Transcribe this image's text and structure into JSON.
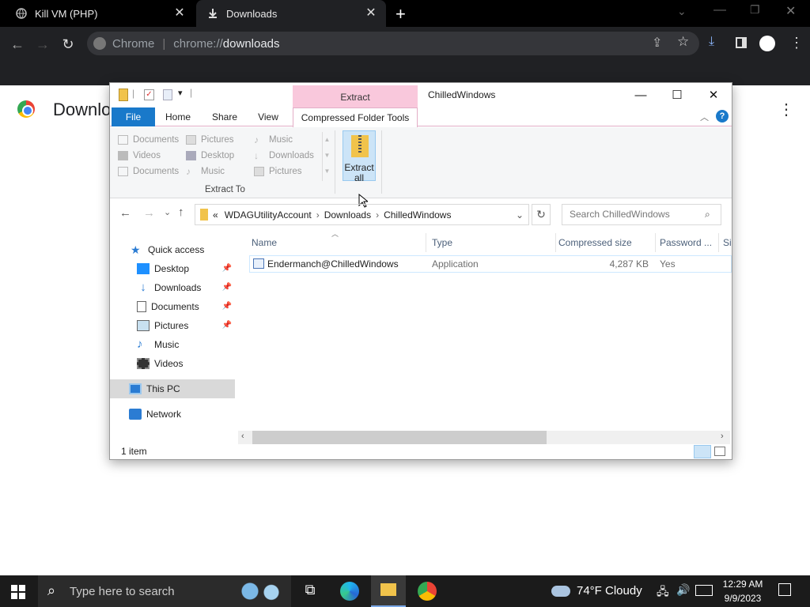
{
  "chrome": {
    "tabs": [
      {
        "label": "Kill VM (PHP)"
      },
      {
        "label": "Downloads"
      }
    ],
    "omnibox": {
      "site": "Chrome",
      "url_prefix": "chrome://",
      "url_path": "downloads"
    },
    "page_title": "Downlo"
  },
  "explorer": {
    "contextual_tab": "Extract",
    "title": "ChilledWindows",
    "ribbon_tabs": [
      "File",
      "Home",
      "Share",
      "View",
      "Compressed Folder Tools"
    ],
    "extract_to_items": [
      [
        "Documents",
        "Pictures",
        "Music"
      ],
      [
        "Videos",
        "Desktop",
        "Downloads"
      ],
      [
        "Documents",
        "Music",
        "Pictures"
      ]
    ],
    "extract_to_label": "Extract To",
    "extract_all_label": "Extract all",
    "breadcrumb": {
      "prefix": "«",
      "parts": [
        "WDAGUtilityAccount",
        "Downloads",
        "ChilledWindows"
      ]
    },
    "search_placeholder": "Search ChilledWindows",
    "nav": [
      {
        "label": "Quick access",
        "pinned": false
      },
      {
        "label": "Desktop",
        "pinned": true
      },
      {
        "label": "Downloads",
        "pinned": true
      },
      {
        "label": "Documents",
        "pinned": true
      },
      {
        "label": "Pictures",
        "pinned": true
      },
      {
        "label": "Music",
        "pinned": false
      },
      {
        "label": "Videos",
        "pinned": false
      },
      {
        "label": "This PC",
        "pinned": false
      },
      {
        "label": "Network",
        "pinned": false
      }
    ],
    "columns": [
      "Name",
      "Type",
      "Compressed size",
      "Password ...",
      "Si"
    ],
    "files": [
      {
        "name": "Endermanch@ChilledWindows",
        "type": "Application",
        "size": "4,287 KB",
        "password": "Yes"
      }
    ],
    "status": "1 item"
  },
  "taskbar": {
    "search_placeholder": "Type here to search",
    "weather": "74°F  Cloudy",
    "time": "12:29 AM",
    "date": "9/9/2023"
  }
}
